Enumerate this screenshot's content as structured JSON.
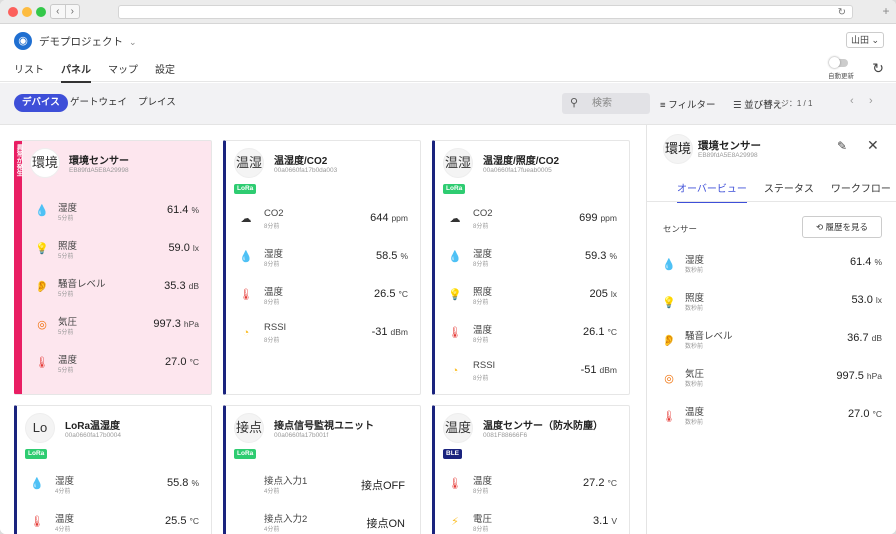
{
  "app": {
    "project": "デモプロジェクト",
    "user": "山田",
    "auto_update": "自動更新",
    "tabs": [
      "リスト",
      "パネル",
      "マップ",
      "設定"
    ]
  },
  "subbar": {
    "pills": [
      "デバイス",
      "ゲートウェイ",
      "プレイス"
    ],
    "search_placeholder": "検索",
    "filter": "フィルター",
    "sort": "並び替え",
    "page": "ページ：1 / 1"
  },
  "cards": [
    {
      "avatar": "環境",
      "title": "環境センサー",
      "id": "EB89fdA5E8A29998",
      "alert": true,
      "alert_text": "異常が発生",
      "badge": "",
      "rows": [
        {
          "icon": "humidity-icon",
          "name": "湿度",
          "time": "5分前",
          "value": "61.4",
          "unit": "%"
        },
        {
          "icon": "illuminance-icon",
          "name": "照度",
          "time": "5分前",
          "value": "59.0",
          "unit": "lx"
        },
        {
          "icon": "noise-icon",
          "name": "騒音レベル",
          "time": "5分前",
          "value": "35.3",
          "unit": "dB"
        },
        {
          "icon": "pressure-icon",
          "name": "気圧",
          "time": "5分前",
          "value": "997.3",
          "unit": "hPa"
        },
        {
          "icon": "temperature-icon",
          "name": "温度",
          "time": "5分前",
          "value": "27.0",
          "unit": "°C"
        }
      ]
    },
    {
      "avatar": "温湿",
      "title": "温湿度/CO2",
      "id": "00a0660fa17b0da003",
      "badge": "LoRa",
      "rows": [
        {
          "icon": "co2-icon",
          "name": "CO2",
          "time": "8分前",
          "value": "644",
          "unit": "ppm"
        },
        {
          "icon": "humidity-icon",
          "name": "湿度",
          "time": "8分前",
          "value": "58.5",
          "unit": "%"
        },
        {
          "icon": "temperature-icon",
          "name": "温度",
          "time": "8分前",
          "value": "26.5",
          "unit": "°C"
        },
        {
          "icon": "rssi-icon",
          "name": "RSSI",
          "time": "8分前",
          "value": "-31",
          "unit": "dBm"
        }
      ]
    },
    {
      "avatar": "温湿",
      "title": "温湿度/照度/CO2",
      "id": "00a0660fa17fueab0005",
      "badge": "LoRa",
      "rows": [
        {
          "icon": "co2-icon",
          "name": "CO2",
          "time": "8分前",
          "value": "699",
          "unit": "ppm"
        },
        {
          "icon": "humidity-icon",
          "name": "湿度",
          "time": "8分前",
          "value": "59.3",
          "unit": "%"
        },
        {
          "icon": "illuminance-icon",
          "name": "照度",
          "time": "8分前",
          "value": "205",
          "unit": "lx"
        },
        {
          "icon": "temperature-icon",
          "name": "温度",
          "time": "8分前",
          "value": "26.1",
          "unit": "°C"
        },
        {
          "icon": "rssi-icon",
          "name": "RSSI",
          "time": "8分前",
          "value": "-51",
          "unit": "dBm"
        }
      ]
    },
    {
      "avatar": "Lo",
      "title": "LoRa温湿度",
      "id": "00a0660fa17b0004",
      "badge": "LoRa",
      "rows": [
        {
          "icon": "humidity-icon",
          "name": "湿度",
          "time": "4分前",
          "value": "55.8",
          "unit": "%"
        },
        {
          "icon": "temperature-icon",
          "name": "温度",
          "time": "4分前",
          "value": "25.5",
          "unit": "°C"
        }
      ]
    },
    {
      "avatar": "接点",
      "title": "接点信号監視ユニット",
      "id": "00a0660fa17b001f",
      "badge": "LoRa",
      "rows": [
        {
          "icon": "",
          "name": "接点入力1",
          "time": "4分前",
          "value": "接点OFF",
          "unit": ""
        },
        {
          "icon": "",
          "name": "接点入力2",
          "time": "4分前",
          "value": "接点ON",
          "unit": ""
        }
      ]
    },
    {
      "avatar": "温度",
      "title": "温度センサー（防水防塵）",
      "id": "0081F88666F6",
      "badge": "BLE",
      "rows": [
        {
          "icon": "temperature-icon",
          "name": "温度",
          "time": "8分前",
          "value": "27.2",
          "unit": "°C"
        },
        {
          "icon": "voltage-icon",
          "name": "電圧",
          "time": "8分前",
          "value": "3.1",
          "unit": "V"
        }
      ]
    }
  ],
  "panel": {
    "avatar": "環境",
    "title": "環境センサー",
    "id": "EB89fdA5E8A29998",
    "tabs": [
      "オーバービュー",
      "ステータス",
      "ワークフロー"
    ],
    "section": "センサー",
    "history_button": "履歴を見る",
    "rows": [
      {
        "icon": "humidity-icon",
        "name": "湿度",
        "time": "数秒前",
        "value": "61.4",
        "unit": "%"
      },
      {
        "icon": "illuminance-icon",
        "name": "照度",
        "time": "数秒前",
        "value": "53.0",
        "unit": "lx"
      },
      {
        "icon": "noise-icon",
        "name": "騒音レベル",
        "time": "数秒前",
        "value": "36.7",
        "unit": "dB"
      },
      {
        "icon": "pressure-icon",
        "name": "気圧",
        "time": "数秒前",
        "value": "997.5",
        "unit": "hPa"
      },
      {
        "icon": "temperature-icon",
        "name": "温度",
        "time": "数秒前",
        "value": "27.0",
        "unit": "°C"
      }
    ]
  },
  "colors": {
    "accent": "#3e4fd8",
    "card_border": "#1a237e",
    "alert": "#e91e63",
    "alert_bg": "#fde6ee",
    "lora": "#2ecc71"
  }
}
